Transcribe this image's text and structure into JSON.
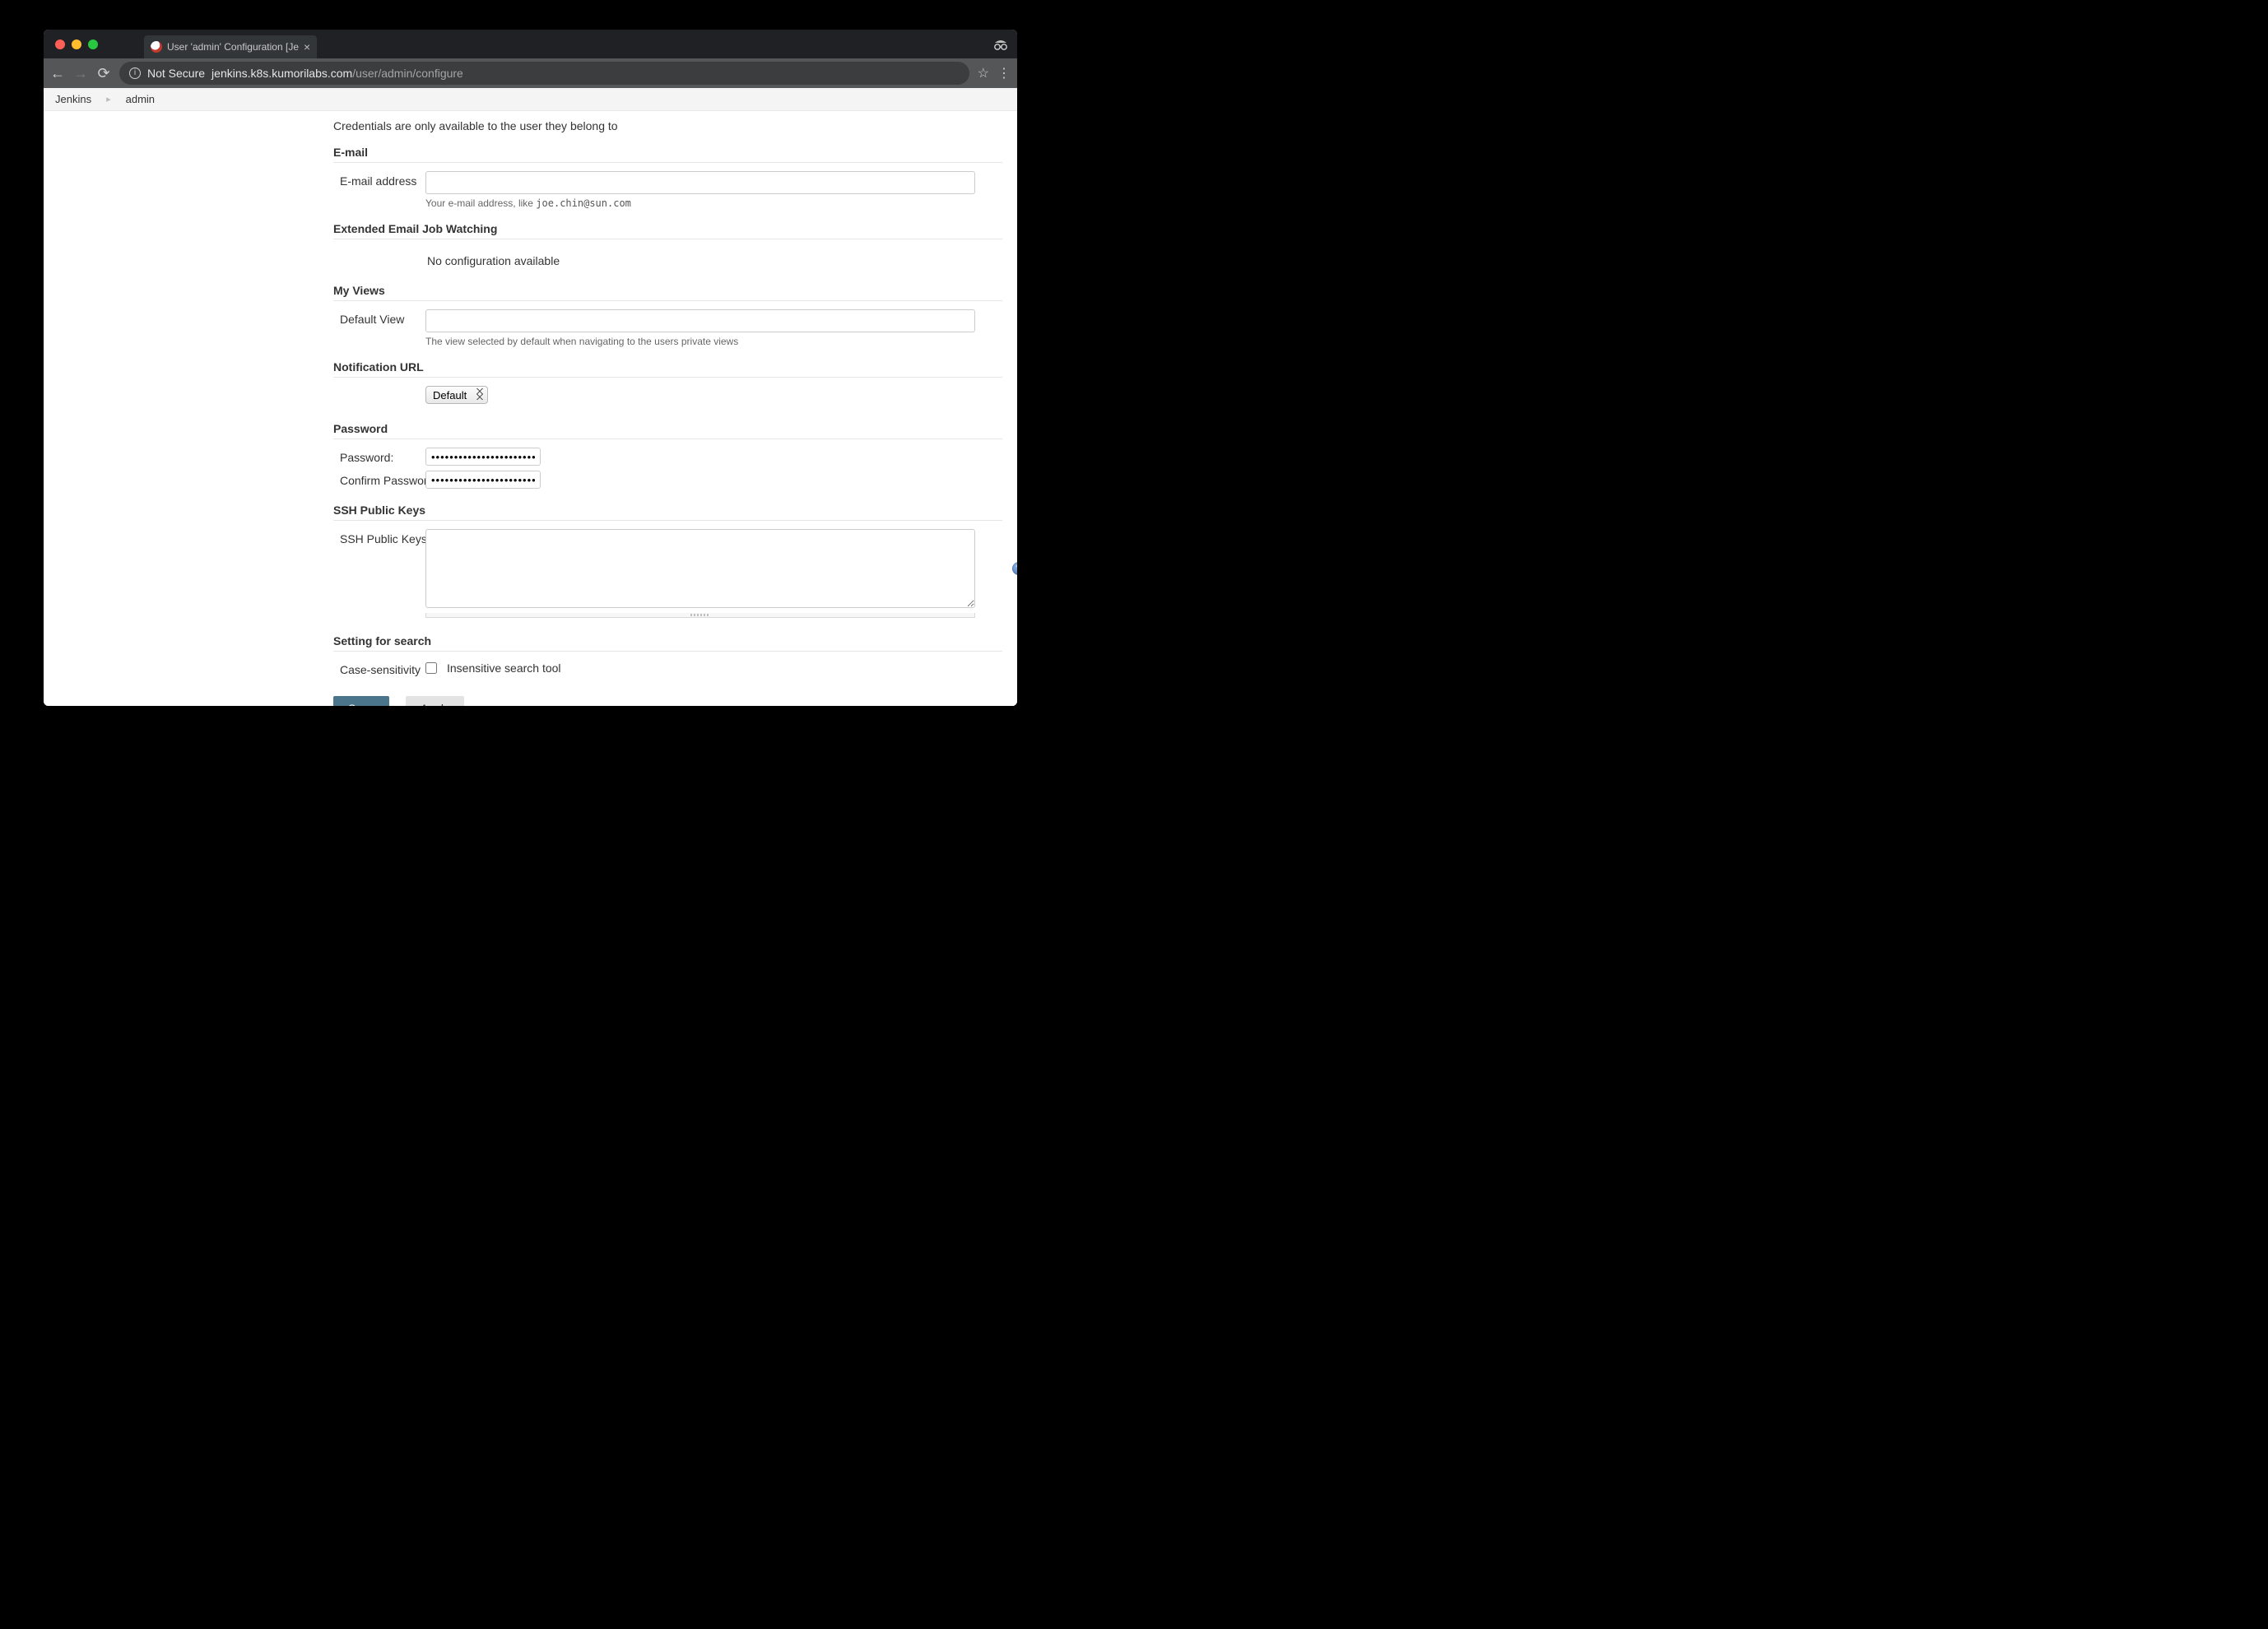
{
  "browser": {
    "tab_title": "User 'admin' Configuration [Je",
    "secure_label": "Not Secure",
    "url_host": "jenkins.k8s.kumorilabs.com",
    "url_path": "/user/admin/configure"
  },
  "breadcrumbs": {
    "items": [
      "Jenkins",
      "admin"
    ]
  },
  "intro_text": "Credentials are only available to the user they belong to",
  "email": {
    "section_title": "E-mail",
    "address_label": "E-mail address",
    "address_value": "",
    "help_prefix": "Your e-mail address, like ",
    "help_example": "joe.chin@sun.com"
  },
  "extended_email": {
    "section_title": "Extended Email Job Watching",
    "message": "No configuration available"
  },
  "my_views": {
    "section_title": "My Views",
    "default_view_label": "Default View",
    "default_view_value": "",
    "help_text": "The view selected by default when navigating to the users private views"
  },
  "notification_url": {
    "section_title": "Notification URL",
    "selected": "Default"
  },
  "password": {
    "section_title": "Password",
    "password_label": "Password:",
    "confirm_label": "Confirm Password:",
    "password_value": "••••••••••••••••••••••••••••",
    "confirm_value": "••••••••••••••••••••••••••••"
  },
  "ssh": {
    "section_title": "SSH Public Keys",
    "field_label": "SSH Public Keys",
    "value": ""
  },
  "search": {
    "section_title": "Setting for search",
    "case_label": "Case-sensitivity",
    "checkbox_label": "Insensitive search tool",
    "checked": false
  },
  "buttons": {
    "save": "Save",
    "apply": "Apply"
  }
}
